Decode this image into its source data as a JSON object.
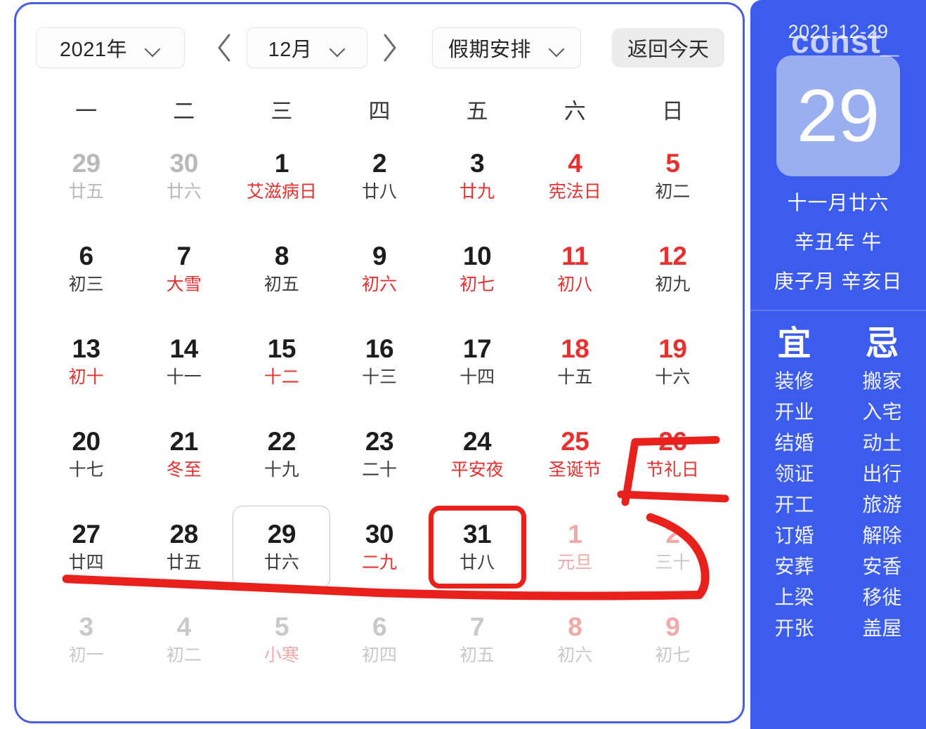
{
  "toolbar": {
    "year_label": "2021年",
    "month_label": "12月",
    "holiday_label": "假期安排",
    "today_button": "返回今天",
    "prev_icon": "chevron-left-icon",
    "next_icon": "chevron-right-icon"
  },
  "weekdays": [
    "一",
    "二",
    "三",
    "四",
    "五",
    "六",
    "日"
  ],
  "weeks": [
    [
      {
        "day": "29",
        "sub": "廿五",
        "day_class": "c-gray",
        "sub_class": "c-gray"
      },
      {
        "day": "30",
        "sub": "廿六",
        "day_class": "c-gray",
        "sub_class": "c-gray"
      },
      {
        "day": "1",
        "sub": "艾滋病日",
        "day_class": "",
        "sub_class": "c-red"
      },
      {
        "day": "2",
        "sub": "廿八",
        "day_class": "",
        "sub_class": ""
      },
      {
        "day": "3",
        "sub": "廿九",
        "day_class": "",
        "sub_class": "c-red"
      },
      {
        "day": "4",
        "sub": "宪法日",
        "day_class": "c-red",
        "sub_class": "c-red"
      },
      {
        "day": "5",
        "sub": "初二",
        "day_class": "c-red",
        "sub_class": ""
      }
    ],
    [
      {
        "day": "6",
        "sub": "初三",
        "day_class": "",
        "sub_class": ""
      },
      {
        "day": "7",
        "sub": "大雪",
        "day_class": "",
        "sub_class": "c-red"
      },
      {
        "day": "8",
        "sub": "初五",
        "day_class": "",
        "sub_class": ""
      },
      {
        "day": "9",
        "sub": "初六",
        "day_class": "",
        "sub_class": "c-red"
      },
      {
        "day": "10",
        "sub": "初七",
        "day_class": "",
        "sub_class": "c-red"
      },
      {
        "day": "11",
        "sub": "初八",
        "day_class": "c-red",
        "sub_class": "c-red"
      },
      {
        "day": "12",
        "sub": "初九",
        "day_class": "c-red",
        "sub_class": ""
      }
    ],
    [
      {
        "day": "13",
        "sub": "初十",
        "day_class": "",
        "sub_class": "c-red"
      },
      {
        "day": "14",
        "sub": "十一",
        "day_class": "",
        "sub_class": ""
      },
      {
        "day": "15",
        "sub": "十二",
        "day_class": "",
        "sub_class": "c-red"
      },
      {
        "day": "16",
        "sub": "十三",
        "day_class": "",
        "sub_class": ""
      },
      {
        "day": "17",
        "sub": "十四",
        "day_class": "",
        "sub_class": ""
      },
      {
        "day": "18",
        "sub": "十五",
        "day_class": "c-red",
        "sub_class": ""
      },
      {
        "day": "19",
        "sub": "十六",
        "day_class": "c-red",
        "sub_class": ""
      }
    ],
    [
      {
        "day": "20",
        "sub": "十七",
        "day_class": "",
        "sub_class": ""
      },
      {
        "day": "21",
        "sub": "冬至",
        "day_class": "",
        "sub_class": "c-red"
      },
      {
        "day": "22",
        "sub": "十九",
        "day_class": "",
        "sub_class": ""
      },
      {
        "day": "23",
        "sub": "二十",
        "day_class": "",
        "sub_class": ""
      },
      {
        "day": "24",
        "sub": "平安夜",
        "day_class": "",
        "sub_class": "c-red"
      },
      {
        "day": "25",
        "sub": "圣诞节",
        "day_class": "c-red",
        "sub_class": "c-red"
      },
      {
        "day": "26",
        "sub": "节礼日",
        "day_class": "c-red",
        "sub_class": "c-red"
      }
    ],
    [
      {
        "day": "27",
        "sub": "廿四",
        "day_class": "",
        "sub_class": ""
      },
      {
        "day": "28",
        "sub": "廿五",
        "day_class": "",
        "sub_class": ""
      },
      {
        "day": "29",
        "sub": "廿六",
        "day_class": "",
        "sub_class": "",
        "state": "today"
      },
      {
        "day": "30",
        "sub": "二九",
        "day_class": "",
        "sub_class": "c-red"
      },
      {
        "day": "31",
        "sub": "廿八",
        "day_class": "",
        "sub_class": "",
        "state": "selected-red"
      },
      {
        "day": "1",
        "sub": "元旦",
        "day_class": "c-faint-red",
        "sub_class": "c-faint-red"
      },
      {
        "day": "2",
        "sub": "三十",
        "day_class": "c-faint-red",
        "sub_class": "c-faint-gray"
      }
    ],
    [
      {
        "day": "3",
        "sub": "初一",
        "day_class": "c-faint-gray",
        "sub_class": "c-faint-gray"
      },
      {
        "day": "4",
        "sub": "初二",
        "day_class": "c-faint-gray",
        "sub_class": "c-faint-gray"
      },
      {
        "day": "5",
        "sub": "小寒",
        "day_class": "c-faint-gray",
        "sub_class": "c-faint-red"
      },
      {
        "day": "6",
        "sub": "初四",
        "day_class": "c-faint-gray",
        "sub_class": "c-faint-gray"
      },
      {
        "day": "7",
        "sub": "初五",
        "day_class": "c-faint-gray",
        "sub_class": "c-faint-gray"
      },
      {
        "day": "8",
        "sub": "初六",
        "day_class": "c-faint-red",
        "sub_class": "c-faint-gray"
      },
      {
        "day": "9",
        "sub": "初七",
        "day_class": "c-faint-red",
        "sub_class": "c-faint-gray"
      }
    ]
  ],
  "sidebar": {
    "date": "2021-12-29",
    "watermark": "const_",
    "big_day": "29",
    "lunar_date": "十一月廿六",
    "lunar_year": "辛丑年 牛",
    "lunar_pillar": "庚子月 辛亥日",
    "yi_head": "宜",
    "ji_head": "忌",
    "yi_items": [
      "装修",
      "开业",
      "结婚",
      "领证",
      "开工",
      "订婚",
      "安葬",
      "上梁",
      "开张"
    ],
    "ji_items": [
      "搬家",
      "入宅",
      "动土",
      "出行",
      "旅游",
      "解除",
      "安香",
      "移徙",
      "盖屋"
    ]
  },
  "colors": {
    "sidebar_blue": "#3c5ced",
    "big_box_blue": "#9aafef",
    "holiday_red": "#e8302f",
    "annotation_red": "#e8211c",
    "panel_border": "#4a5ee0"
  }
}
